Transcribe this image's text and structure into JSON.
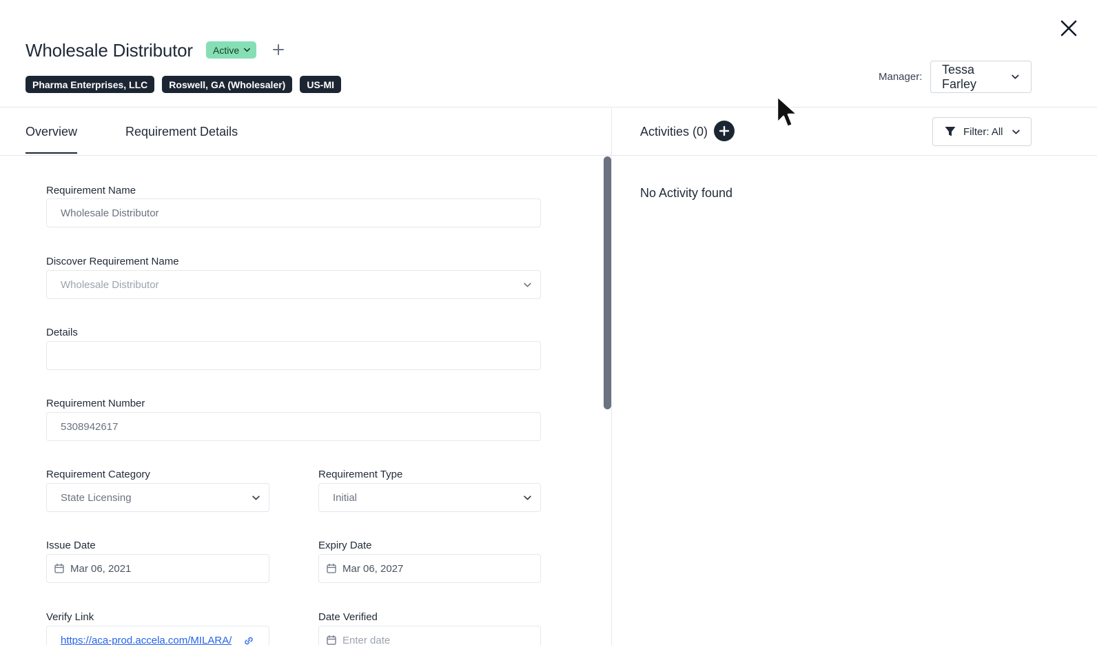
{
  "header": {
    "title": "Wholesale Distributor",
    "status": "Active",
    "tags": [
      "Pharma Enterprises, LLC",
      "Roswell, GA (Wholesaler)",
      "US-MI"
    ],
    "manager_label": "Manager:",
    "manager_value": "Tessa Farley"
  },
  "tabs": [
    {
      "label": "Overview",
      "active": true
    },
    {
      "label": "Requirement Details",
      "active": false
    }
  ],
  "form": {
    "requirement_name": {
      "label": "Requirement Name",
      "value": "Wholesale Distributor"
    },
    "discover_requirement_name": {
      "label": "Discover Requirement Name",
      "value": "Wholesale Distributor"
    },
    "details": {
      "label": "Details",
      "value": ""
    },
    "requirement_number": {
      "label": "Requirement Number",
      "value": "5308942617"
    },
    "requirement_category": {
      "label": "Requirement Category",
      "value": "State Licensing"
    },
    "requirement_type": {
      "label": "Requirement Type",
      "value": "Initial"
    },
    "issue_date": {
      "label": "Issue Date",
      "value": "Mar 06, 2021"
    },
    "expiry_date": {
      "label": "Expiry Date",
      "value": "Mar 06, 2027"
    },
    "verify_link": {
      "label": "Verify Link",
      "value": "https://aca-prod.accela.com/MILARA/"
    },
    "date_verified": {
      "label": "Date Verified",
      "placeholder": "Enter date"
    }
  },
  "activities": {
    "title": "Activities (0)",
    "filter_label": "Filter: All",
    "empty_text": "No Activity found"
  },
  "colors": {
    "status_bg": "#86dfb4",
    "tag_bg": "#1c2633",
    "link": "#2563eb"
  },
  "icons": [
    "chevron-down-icon",
    "plus-icon",
    "close-icon",
    "calendar-icon",
    "link-icon",
    "filter-icon",
    "plus-circle-icon",
    "mouse-cursor-icon"
  ]
}
